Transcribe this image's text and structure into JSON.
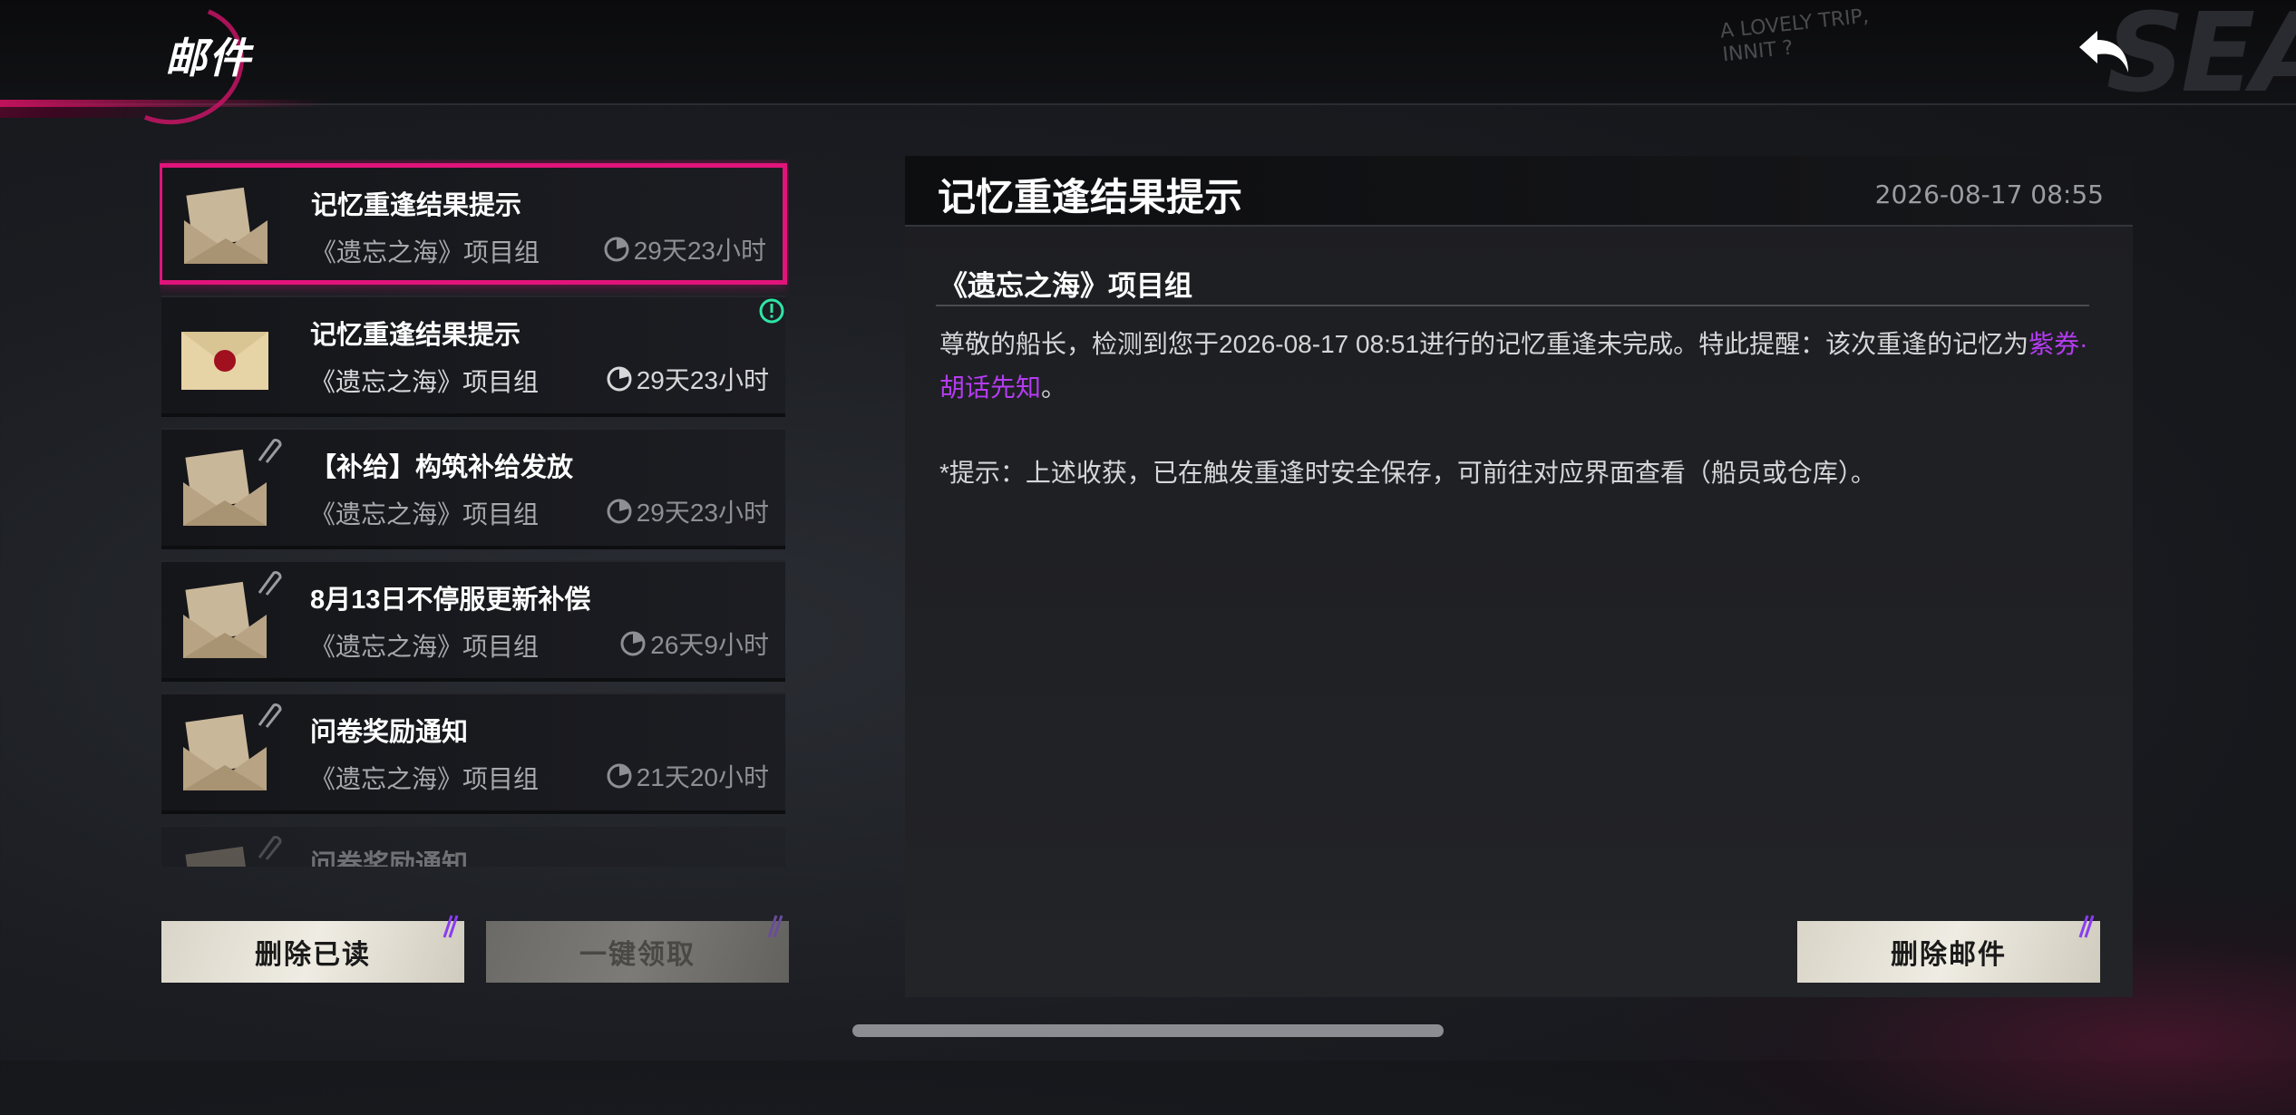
{
  "header": {
    "title": "邮件",
    "deco_text_line1": "A LOVELY TRIP,",
    "deco_text_line2": "INNIT ?",
    "deco_big": "SEA",
    "back_icon": "back-arrow-icon"
  },
  "mail_list": {
    "items": [
      {
        "title": "记忆重逢结果提示",
        "sender": "《遗忘之海》项目组",
        "expire": "29天23小时",
        "state": "selected",
        "icon": "opened-envelope-icon",
        "has_attachment": false,
        "new": false
      },
      {
        "title": "记忆重逢结果提示",
        "sender": "《遗忘之海》项目组",
        "expire": "29天23小时",
        "state": "unread",
        "icon": "sealed-envelope-icon",
        "has_attachment": false,
        "new": true
      },
      {
        "title": "【补给】构筑补给发放",
        "sender": "《遗忘之海》项目组",
        "expire": "29天23小时",
        "state": "read",
        "icon": "opened-envelope-icon",
        "has_attachment": true,
        "new": false
      },
      {
        "title": "8月13日不停服更新补偿",
        "sender": "《遗忘之海》项目组",
        "expire": "26天9小时",
        "state": "read",
        "icon": "opened-envelope-icon",
        "has_attachment": true,
        "new": false
      },
      {
        "title": "问卷奖励通知",
        "sender": "《遗忘之海》项目组",
        "expire": "21天20小时",
        "state": "read",
        "icon": "opened-envelope-icon",
        "has_attachment": true,
        "new": false
      },
      {
        "title": "问卷奖励通知",
        "sender": "",
        "expire": "",
        "state": "faded",
        "icon": "opened-envelope-icon",
        "has_attachment": true,
        "new": false
      }
    ]
  },
  "buttons": {
    "delete_read": "删除已读",
    "claim_all": "一键领取",
    "delete_mail": "删除邮件"
  },
  "detail": {
    "title": "记忆重逢结果提示",
    "date": "2026-08-17 08:55",
    "sender": "《遗忘之海》项目组",
    "body_prefix": "尊敬的船长，检测到您于2026-08-17 08:51进行的记忆重逢未完成。特此提醒：该次重逢的记忆为",
    "body_highlight": "紫券·胡话先知",
    "body_suffix": "。",
    "note": "*提示：上述收获，已在触发重逢时安全保存，可前往对应界面查看（船员或仓库）。"
  },
  "colors": {
    "accent_pink": "#e0147a",
    "highlight_purple": "#b43cf0",
    "button_cream": "#efece3",
    "new_badge_green": "#2ee6a6"
  }
}
